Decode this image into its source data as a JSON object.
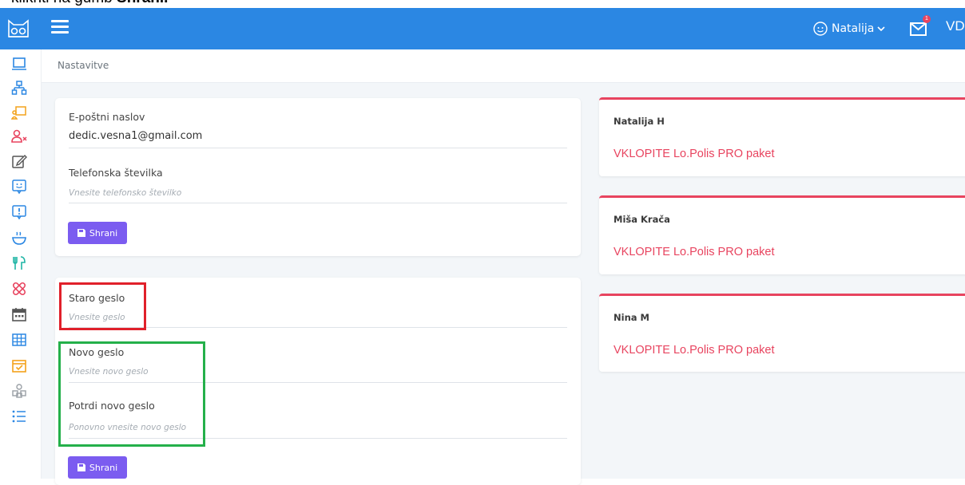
{
  "caption": {
    "text": "kliknti na gumb ",
    "bold": "Shrani."
  },
  "topbar": {
    "user_name": "Natalija",
    "notification_count": "1",
    "initials": "VD"
  },
  "sidebar": {
    "icons": [
      "monitor-icon",
      "hierarchy-icon",
      "presentation-icon",
      "user-remove-icon",
      "edit-icon",
      "smile-message-icon",
      "alert-message-icon",
      "bowl-icon",
      "cutlery-icon",
      "bandage-icon",
      "calendar-icon",
      "grid-icon",
      "calendar-check-icon",
      "shapes-icon",
      "list-icon"
    ],
    "colors": [
      "#2b87e3",
      "#2b87e3",
      "#f3a21b",
      "#e8445f",
      "#555555",
      "#2b87e3",
      "#2b87e3",
      "#2b87e3",
      "#1fb5a5",
      "#e8445f",
      "#555555",
      "#2b87e3",
      "#f3a21b",
      "#9aa0a6",
      "#2b87e3"
    ]
  },
  "breadcrumb": "Nastavitve",
  "contact": {
    "email_label": "E-poštni naslov",
    "email_value": "dedic.vesna1@gmail.com",
    "phone_label": "Telefonska številka",
    "phone_placeholder": "Vnesite telefonsko številko",
    "save_label": "Shrani"
  },
  "password": {
    "old_label": "Staro geslo",
    "old_placeholder": "Vnesite geslo",
    "new_label": "Novo geslo",
    "new_placeholder": "Vnesite novo geslo",
    "confirm_label": "Potrdi novo geslo",
    "confirm_placeholder": "Ponovno vnesite novo geslo",
    "save_label": "Shrani"
  },
  "members": [
    {
      "name": "Natalija H",
      "cta": "VKLOPITE Lo.Polis PRO paket"
    },
    {
      "name": "Miša Krača",
      "cta": "VKLOPITE Lo.Polis PRO paket"
    },
    {
      "name": "Nina M",
      "cta": "VKLOPITE Lo.Polis PRO paket"
    }
  ],
  "colors": {
    "topbar": "#2b87e3",
    "button": "#7b5cf0",
    "accent": "#e8445f",
    "highlight_old": "#e0202a",
    "highlight_new": "#24b04a"
  }
}
